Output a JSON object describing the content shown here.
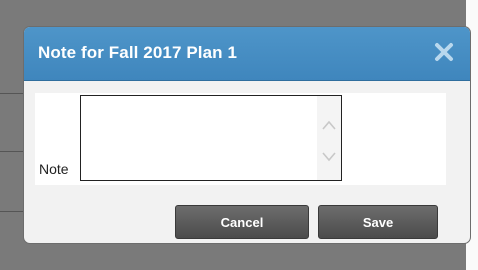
{
  "dialog": {
    "title": "Note for Fall 2017 Plan 1",
    "close_icon": "close-icon",
    "note_label": "Note",
    "note_value": "",
    "cancel_label": "Cancel",
    "save_label": "Save"
  },
  "colors": {
    "titlebar": "#4e95c9",
    "button": "#5a5a5a",
    "overlay": "#7a7a7a"
  }
}
